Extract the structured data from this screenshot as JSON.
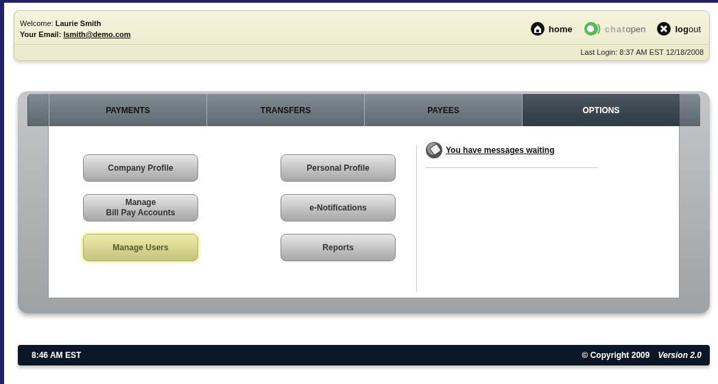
{
  "header": {
    "welcome_label": "Welcome:",
    "user_name": "Laurie Smith",
    "email_label": "Your Email:",
    "email": "lsmith@demo.com",
    "links": [
      {
        "kind": "home",
        "strong": "home",
        "disabled": false
      },
      {
        "kind": "chat",
        "strong": "chat",
        "rest": "open",
        "disabled": true
      },
      {
        "kind": "logout",
        "strong": "log",
        "rest": "out",
        "disabled": false
      }
    ],
    "last_login": "Last Login: 8:37 AM EST 12/18/2008"
  },
  "tabs": [
    {
      "label": "PAYMENTS",
      "selected": false
    },
    {
      "label": "TRANSFERS",
      "selected": false
    },
    {
      "label": "PAYEES",
      "selected": false
    },
    {
      "label": "OPTIONS",
      "selected": true
    }
  ],
  "buttons": [
    {
      "label": "Company Profile",
      "selected": false
    },
    {
      "label": "Personal Profile",
      "selected": false
    },
    {
      "label": "Manage\nBill Pay Accounts",
      "selected": false
    },
    {
      "label": "e-Notifications",
      "selected": false
    },
    {
      "label": "Manage Users",
      "selected": true
    },
    {
      "label": "Reports",
      "selected": false
    }
  ],
  "message": "You have messages waiting",
  "footer": {
    "time": "8:46 AM EST",
    "copyright": "© Copyright 2009",
    "version": "Version 2.0"
  }
}
